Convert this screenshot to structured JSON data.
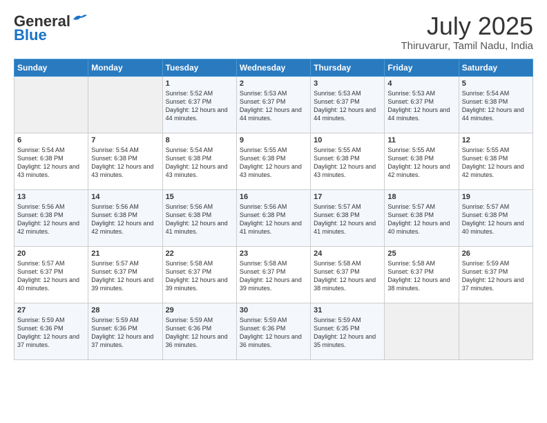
{
  "logo": {
    "line1": "General",
    "line2": "Blue"
  },
  "title": "July 2025",
  "subtitle": "Thiruvarur, Tamil Nadu, India",
  "days_of_week": [
    "Sunday",
    "Monday",
    "Tuesday",
    "Wednesday",
    "Thursday",
    "Friday",
    "Saturday"
  ],
  "weeks": [
    [
      {
        "day": "",
        "empty": true
      },
      {
        "day": "",
        "empty": true
      },
      {
        "day": "1",
        "sunrise": "5:52 AM",
        "sunset": "6:37 PM",
        "daylight": "12 hours and 44 minutes."
      },
      {
        "day": "2",
        "sunrise": "5:53 AM",
        "sunset": "6:37 PM",
        "daylight": "12 hours and 44 minutes."
      },
      {
        "day": "3",
        "sunrise": "5:53 AM",
        "sunset": "6:37 PM",
        "daylight": "12 hours and 44 minutes."
      },
      {
        "day": "4",
        "sunrise": "5:53 AM",
        "sunset": "6:37 PM",
        "daylight": "12 hours and 44 minutes."
      },
      {
        "day": "5",
        "sunrise": "5:54 AM",
        "sunset": "6:38 PM",
        "daylight": "12 hours and 44 minutes."
      }
    ],
    [
      {
        "day": "6",
        "sunrise": "5:54 AM",
        "sunset": "6:38 PM",
        "daylight": "12 hours and 43 minutes."
      },
      {
        "day": "7",
        "sunrise": "5:54 AM",
        "sunset": "6:38 PM",
        "daylight": "12 hours and 43 minutes."
      },
      {
        "day": "8",
        "sunrise": "5:54 AM",
        "sunset": "6:38 PM",
        "daylight": "12 hours and 43 minutes."
      },
      {
        "day": "9",
        "sunrise": "5:55 AM",
        "sunset": "6:38 PM",
        "daylight": "12 hours and 43 minutes."
      },
      {
        "day": "10",
        "sunrise": "5:55 AM",
        "sunset": "6:38 PM",
        "daylight": "12 hours and 43 minutes."
      },
      {
        "day": "11",
        "sunrise": "5:55 AM",
        "sunset": "6:38 PM",
        "daylight": "12 hours and 42 minutes."
      },
      {
        "day": "12",
        "sunrise": "5:55 AM",
        "sunset": "6:38 PM",
        "daylight": "12 hours and 42 minutes."
      }
    ],
    [
      {
        "day": "13",
        "sunrise": "5:56 AM",
        "sunset": "6:38 PM",
        "daylight": "12 hours and 42 minutes."
      },
      {
        "day": "14",
        "sunrise": "5:56 AM",
        "sunset": "6:38 PM",
        "daylight": "12 hours and 42 minutes."
      },
      {
        "day": "15",
        "sunrise": "5:56 AM",
        "sunset": "6:38 PM",
        "daylight": "12 hours and 41 minutes."
      },
      {
        "day": "16",
        "sunrise": "5:56 AM",
        "sunset": "6:38 PM",
        "daylight": "12 hours and 41 minutes."
      },
      {
        "day": "17",
        "sunrise": "5:57 AM",
        "sunset": "6:38 PM",
        "daylight": "12 hours and 41 minutes."
      },
      {
        "day": "18",
        "sunrise": "5:57 AM",
        "sunset": "6:38 PM",
        "daylight": "12 hours and 40 minutes."
      },
      {
        "day": "19",
        "sunrise": "5:57 AM",
        "sunset": "6:38 PM",
        "daylight": "12 hours and 40 minutes."
      }
    ],
    [
      {
        "day": "20",
        "sunrise": "5:57 AM",
        "sunset": "6:37 PM",
        "daylight": "12 hours and 40 minutes."
      },
      {
        "day": "21",
        "sunrise": "5:57 AM",
        "sunset": "6:37 PM",
        "daylight": "12 hours and 39 minutes."
      },
      {
        "day": "22",
        "sunrise": "5:58 AM",
        "sunset": "6:37 PM",
        "daylight": "12 hours and 39 minutes."
      },
      {
        "day": "23",
        "sunrise": "5:58 AM",
        "sunset": "6:37 PM",
        "daylight": "12 hours and 39 minutes."
      },
      {
        "day": "24",
        "sunrise": "5:58 AM",
        "sunset": "6:37 PM",
        "daylight": "12 hours and 38 minutes."
      },
      {
        "day": "25",
        "sunrise": "5:58 AM",
        "sunset": "6:37 PM",
        "daylight": "12 hours and 38 minutes."
      },
      {
        "day": "26",
        "sunrise": "5:59 AM",
        "sunset": "6:37 PM",
        "daylight": "12 hours and 37 minutes."
      }
    ],
    [
      {
        "day": "27",
        "sunrise": "5:59 AM",
        "sunset": "6:36 PM",
        "daylight": "12 hours and 37 minutes."
      },
      {
        "day": "28",
        "sunrise": "5:59 AM",
        "sunset": "6:36 PM",
        "daylight": "12 hours and 37 minutes."
      },
      {
        "day": "29",
        "sunrise": "5:59 AM",
        "sunset": "6:36 PM",
        "daylight": "12 hours and 36 minutes."
      },
      {
        "day": "30",
        "sunrise": "5:59 AM",
        "sunset": "6:36 PM",
        "daylight": "12 hours and 36 minutes."
      },
      {
        "day": "31",
        "sunrise": "5:59 AM",
        "sunset": "6:35 PM",
        "daylight": "12 hours and 35 minutes."
      },
      {
        "day": "",
        "empty": true
      },
      {
        "day": "",
        "empty": true
      }
    ]
  ]
}
